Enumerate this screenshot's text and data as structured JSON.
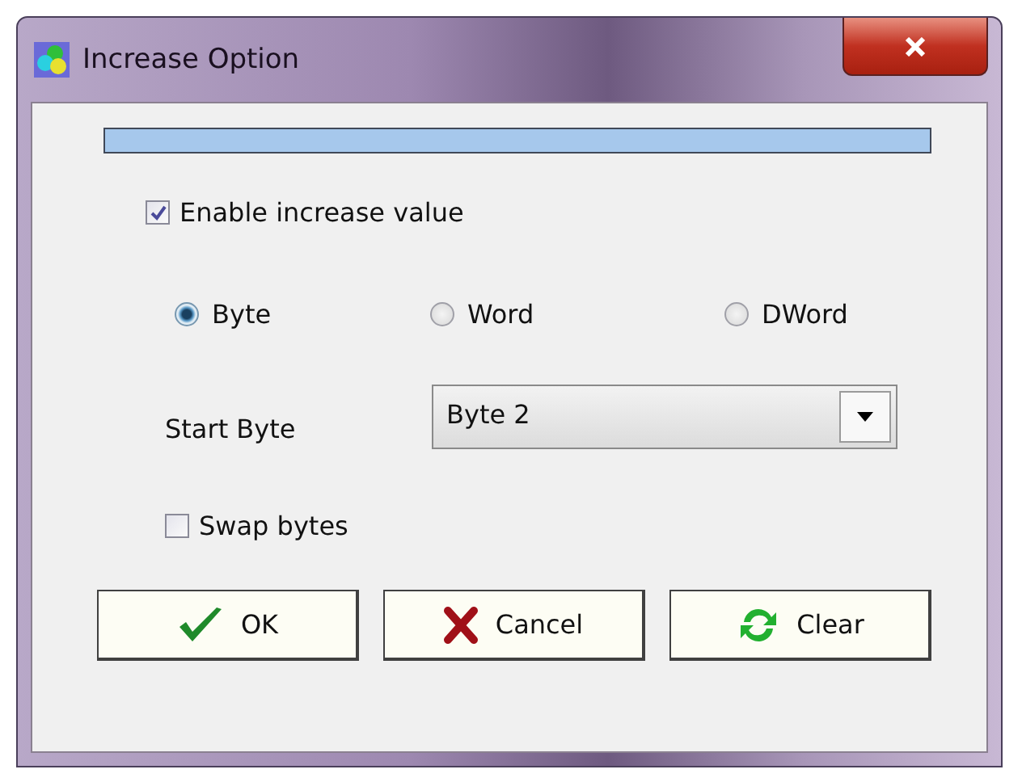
{
  "window": {
    "title": "Increase Option"
  },
  "enable_increase": {
    "label": "Enable increase value",
    "checked": true
  },
  "size_options": [
    {
      "label": "Byte",
      "selected": true
    },
    {
      "label": "Word",
      "selected": false
    },
    {
      "label": "DWord",
      "selected": false
    }
  ],
  "start_byte": {
    "label": "Start Byte",
    "value": "Byte 2"
  },
  "swap_bytes": {
    "label": "Swap bytes",
    "checked": false
  },
  "buttons": [
    {
      "kind": "ok",
      "label": "OK"
    },
    {
      "kind": "cancel",
      "label": "Cancel"
    },
    {
      "kind": "clear",
      "label": "Clear"
    }
  ]
}
